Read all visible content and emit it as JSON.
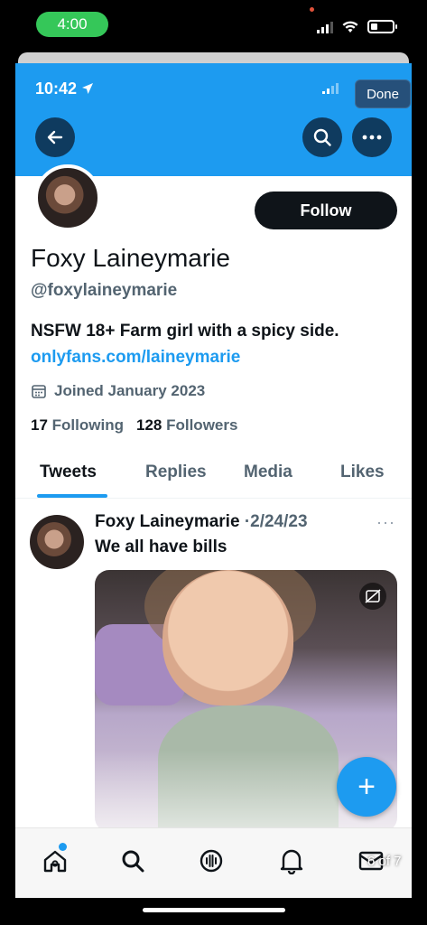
{
  "outer_status": {
    "time": "4:00"
  },
  "inner_status": {
    "time": "10:42",
    "done_label": "Done"
  },
  "profile": {
    "follow_label": "Follow",
    "name": "Foxy Laineymarie",
    "handle": "@foxylaineymarie",
    "bio": "NSFW 18+ Farm girl with a spicy side.",
    "link": "onlyfans.com/laineymarie",
    "joined": "Joined January 2023",
    "following_count": "17",
    "following_label": "Following",
    "followers_count": "128",
    "followers_label": "Followers"
  },
  "tabs": [
    {
      "label": "Tweets"
    },
    {
      "label": "Replies"
    },
    {
      "label": "Media"
    },
    {
      "label": "Likes"
    }
  ],
  "tweet": {
    "author": "Foxy Laineymarie",
    "separator": "·",
    "date": "2/24/23",
    "more": "···",
    "text": "We all have bills"
  },
  "fab": {
    "icon": "plus-icon",
    "label": "+"
  },
  "bottom_nav": {
    "counter": "6 of 7"
  },
  "colors": {
    "accent": "#1d9bf0",
    "dark": "#0f1419",
    "muted": "#536471",
    "status_pill": "#35c759"
  }
}
